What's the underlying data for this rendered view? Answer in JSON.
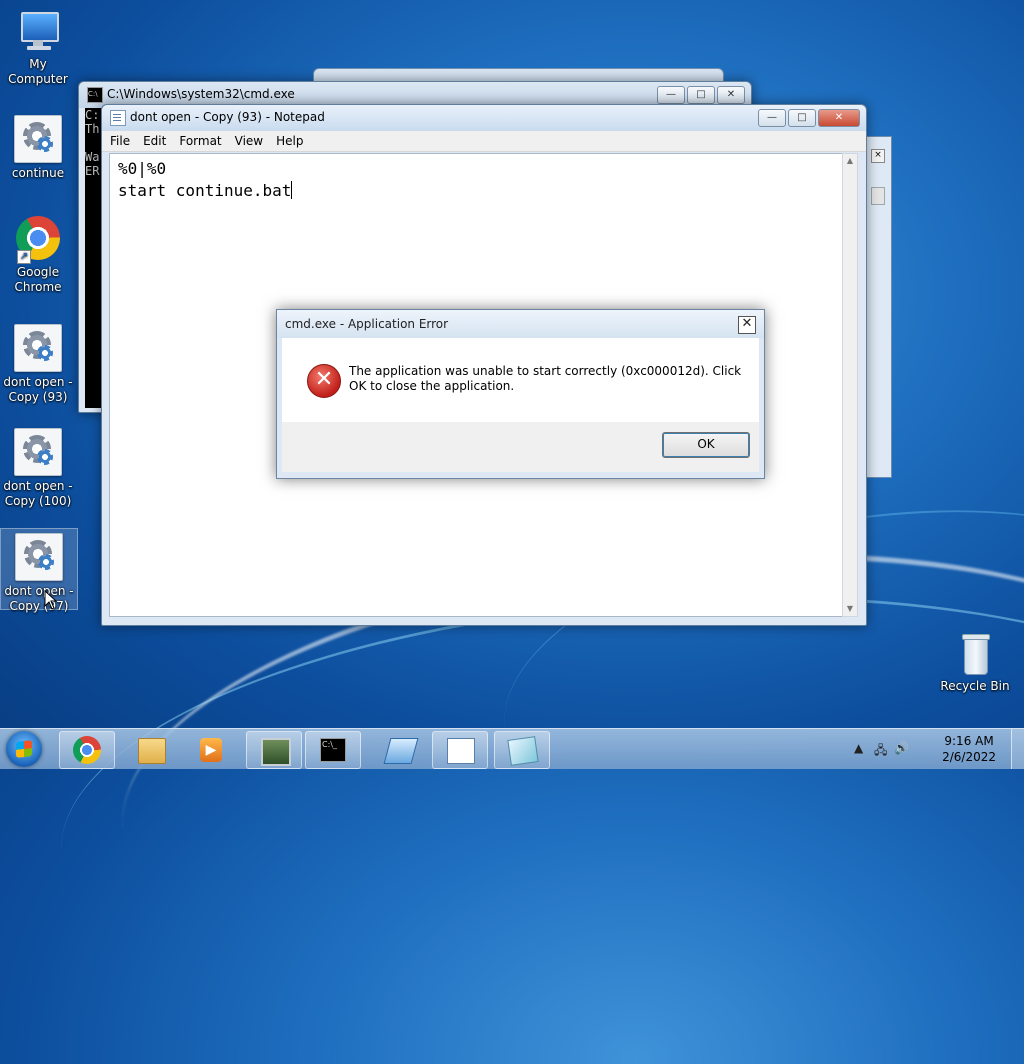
{
  "desktop": {
    "icons": [
      {
        "label": "My Computer"
      },
      {
        "label": "continue"
      },
      {
        "label": "Google Chrome"
      },
      {
        "label": "dont open - Copy (93)"
      },
      {
        "label": "dont open - Copy (100)"
      },
      {
        "label": "dont open - Copy (97)"
      },
      {
        "label": "Recycle Bin"
      }
    ]
  },
  "cmd_window": {
    "title": "C:\\Windows\\system32\\cmd.exe",
    "lines": [
      "C:",
      "Th",
      "",
      "Wa",
      "ER"
    ]
  },
  "notepad": {
    "title": "dont open - Copy (93) - Notepad",
    "menu": [
      "File",
      "Edit",
      "Format",
      "View",
      "Help"
    ],
    "content_line1": "%0|%0",
    "content_line2": "start continue.bat"
  },
  "dialog": {
    "title": "cmd.exe - Application Error",
    "message": "The application was unable to start correctly (0xc000012d). Click OK to close the application.",
    "ok_label": "OK",
    "close_glyph": "✕",
    "icon": "error-icon"
  },
  "window_controls": {
    "minimize": "—",
    "maximize": "□",
    "close": "✕"
  },
  "taskbar": {
    "time": "9:16 AM",
    "date": "2/6/2022",
    "buttons": [
      "start-button",
      "chrome",
      "explorer",
      "media-player",
      "network-app",
      "cmd",
      "remote",
      "notepad",
      "app"
    ]
  },
  "colors": {
    "error_red": "#c0201a",
    "accent": "#1f6fc0"
  }
}
